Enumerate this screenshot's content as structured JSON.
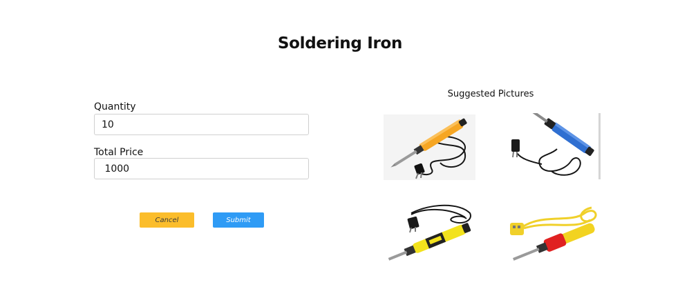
{
  "page": {
    "title": "Soldering Iron"
  },
  "form": {
    "quantity_label": "Quantity",
    "quantity_value": "10",
    "total_price_label": "Total Price",
    "total_price_value": " 1000",
    "cancel_label": "Cancel",
    "submit_label": "Submit"
  },
  "suggestions": {
    "title": "Suggested Pictures",
    "pictures": [
      {
        "icon": "soldering-iron-orange-image"
      },
      {
        "icon": "soldering-iron-blue-image"
      },
      {
        "icon": "soldering-iron-yellow-black-image"
      },
      {
        "icon": "soldering-iron-yellow-red-image"
      }
    ]
  },
  "colors": {
    "cancel_button": "#fbbd2b",
    "submit_button": "#2f9bf5"
  }
}
